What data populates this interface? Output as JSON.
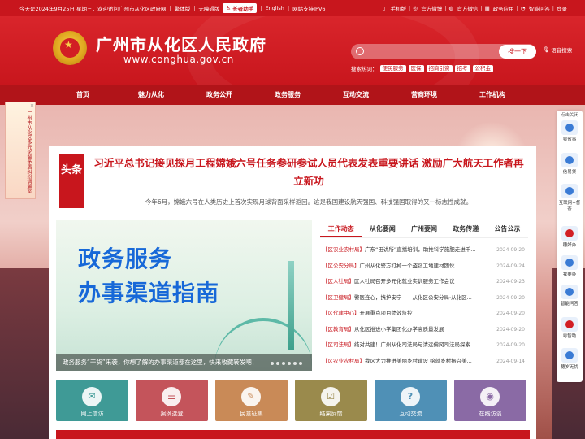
{
  "topbar": {
    "left": [
      "今天是2024年9月25日 星期三，欢迎访问广州市从化区政府网",
      "繁体版",
      "无障碍版"
    ],
    "elder_btn": "长者助手",
    "english": "English",
    "ipv6": "网站支持IPV6",
    "right": [
      "手机版",
      "官方微博",
      "官方微信",
      "政务应用",
      "智能问答",
      "登录"
    ]
  },
  "header": {
    "title": "广州市从化区人民政府",
    "url": "www.conghua.gov.cn",
    "search_btn": "搜一下",
    "voice": "语音搜索",
    "hot_label": "搜索热词：",
    "hot_tags": [
      "便民服务",
      "医保",
      "招商引资",
      "招考",
      "公积金"
    ]
  },
  "nav": [
    "首页",
    "魅力从化",
    "政务公开",
    "政务服务",
    "互动交流",
    "营商环境",
    "工作机构"
  ],
  "side_banner": {
    "text": "广州市从化区多元化解矛盾纠纷调解室",
    "close": "×"
  },
  "float_bar": {
    "head": "点击关闭",
    "items": [
      "粤省事",
      "信易贷",
      "互联网+督查",
      "穗好办",
      "我要办",
      "智能问答",
      "粤智助",
      "穗岁无忧"
    ]
  },
  "headline": {
    "tag": "头条",
    "title": "习近平总书记接见探月工程嫦娥六号任务参研参试人员代表发表重要讲话 激励广大航天工作者再立新功",
    "sub": "今年6月，嫦娥六号在人类历史上首次实现月球背面采样返回。这是我国建设航天强国、科技强国取得的又一标志性成就。"
  },
  "slide": {
    "line1": "政务服务",
    "line2": "办事渠道指南",
    "caption": "政务服务“干货”来袭，你想了解的办事渠道都在这里，快来收藏转发吧！"
  },
  "tabs": [
    "工作动态",
    "从化要闻",
    "广州要闻",
    "政务传递",
    "公告公示"
  ],
  "news": [
    {
      "cat": "【区农业农村局】",
      "title": "广东“田讲所”直播培训，助推科学施肥走进千...",
      "date": "2024-09-20"
    },
    {
      "cat": "【区公安分局】",
      "title": "广州从化警方打掉一个盗窃工地建材团伙",
      "date": "2024-09-24"
    },
    {
      "cat": "【区人社局】",
      "title": "区人社局召开多元化就业实训服务工作会议",
      "date": "2024-09-23"
    },
    {
      "cat": "【区卫健局】",
      "title": "警医连心，携护安宁——从化区公安分局·从化区...",
      "date": "2024-09-20"
    },
    {
      "cat": "【区代建中心】",
      "title": "开展重点项目绩效监控",
      "date": "2024-09-20"
    },
    {
      "cat": "【区教育局】",
      "title": "从化区推进小学集团化办学高质量发展",
      "date": "2024-09-20"
    },
    {
      "cat": "【区司法局】",
      "title": "结对共建！广州从化司法局与清远佛冈司法局探索...",
      "date": "2024-09-20"
    },
    {
      "cat": "【区农业农村局】",
      "title": "我区大力推进美丽乡村建设 绘就乡村振兴美...",
      "date": "2024-09-14"
    }
  ],
  "tiles": [
    {
      "label": "网上信访",
      "color": "#3f9a96",
      "glyph": "✉"
    },
    {
      "label": "案例选登",
      "color": "#c4545b",
      "glyph": "☰"
    },
    {
      "label": "民意征集",
      "color": "#c98a57",
      "glyph": "✎"
    },
    {
      "label": "结果反馈",
      "color": "#9a8a4c",
      "glyph": "☑"
    },
    {
      "label": "互动交流",
      "color": "#4f90b6",
      "glyph": "?"
    },
    {
      "label": "在线访谈",
      "color": "#8a6aa5",
      "glyph": "◉"
    }
  ]
}
